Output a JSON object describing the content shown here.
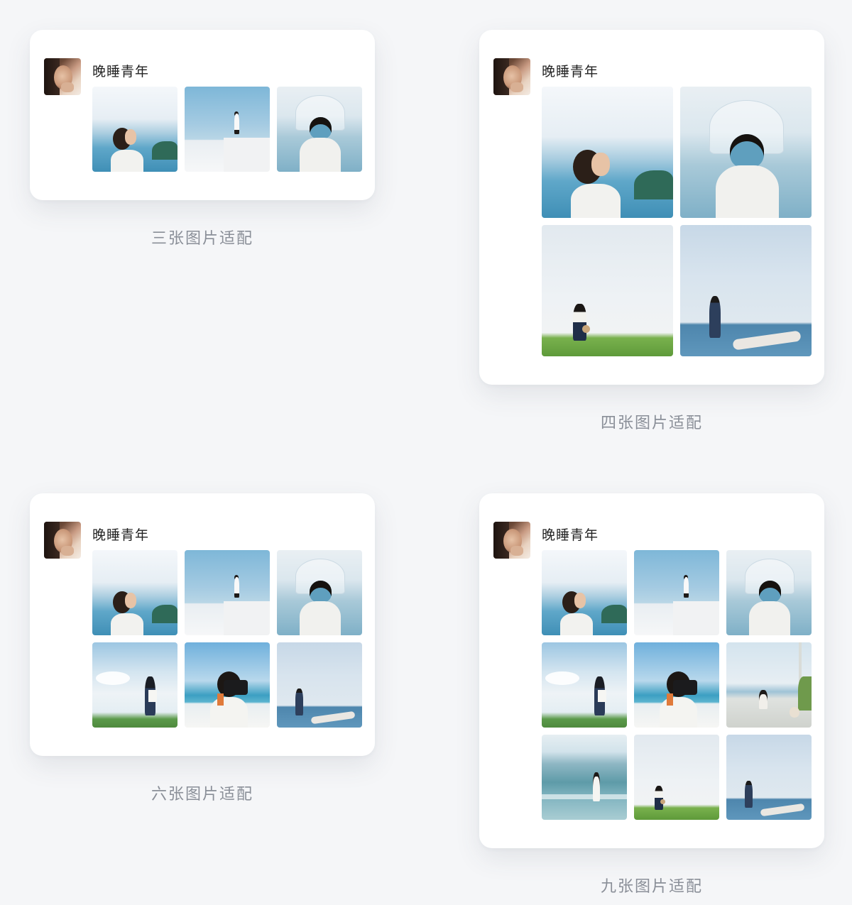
{
  "username": "晚睡青年",
  "captions": {
    "three": "三张图片适配",
    "four": "四张图片适配",
    "six": "六张图片适配",
    "nine": "九张图片适配"
  },
  "posts": [
    {
      "id": "three",
      "photo_count": 3,
      "photos": [
        "sea-girl",
        "stand-white",
        "umbrella"
      ]
    },
    {
      "id": "four",
      "photo_count": 4,
      "photos": [
        "sea-girl",
        "umbrella",
        "grass-hat",
        "driftwood"
      ]
    },
    {
      "id": "six",
      "photo_count": 6,
      "photos": [
        "sea-girl",
        "stand-white",
        "umbrella",
        "wind-girl",
        "camera-girl",
        "driftwood"
      ]
    },
    {
      "id": "nine",
      "photo_count": 9,
      "photos": [
        "sea-girl",
        "stand-white",
        "umbrella",
        "wind-girl",
        "camera-girl",
        "coast-dog",
        "waves",
        "grass-hat",
        "driftwood"
      ]
    }
  ]
}
